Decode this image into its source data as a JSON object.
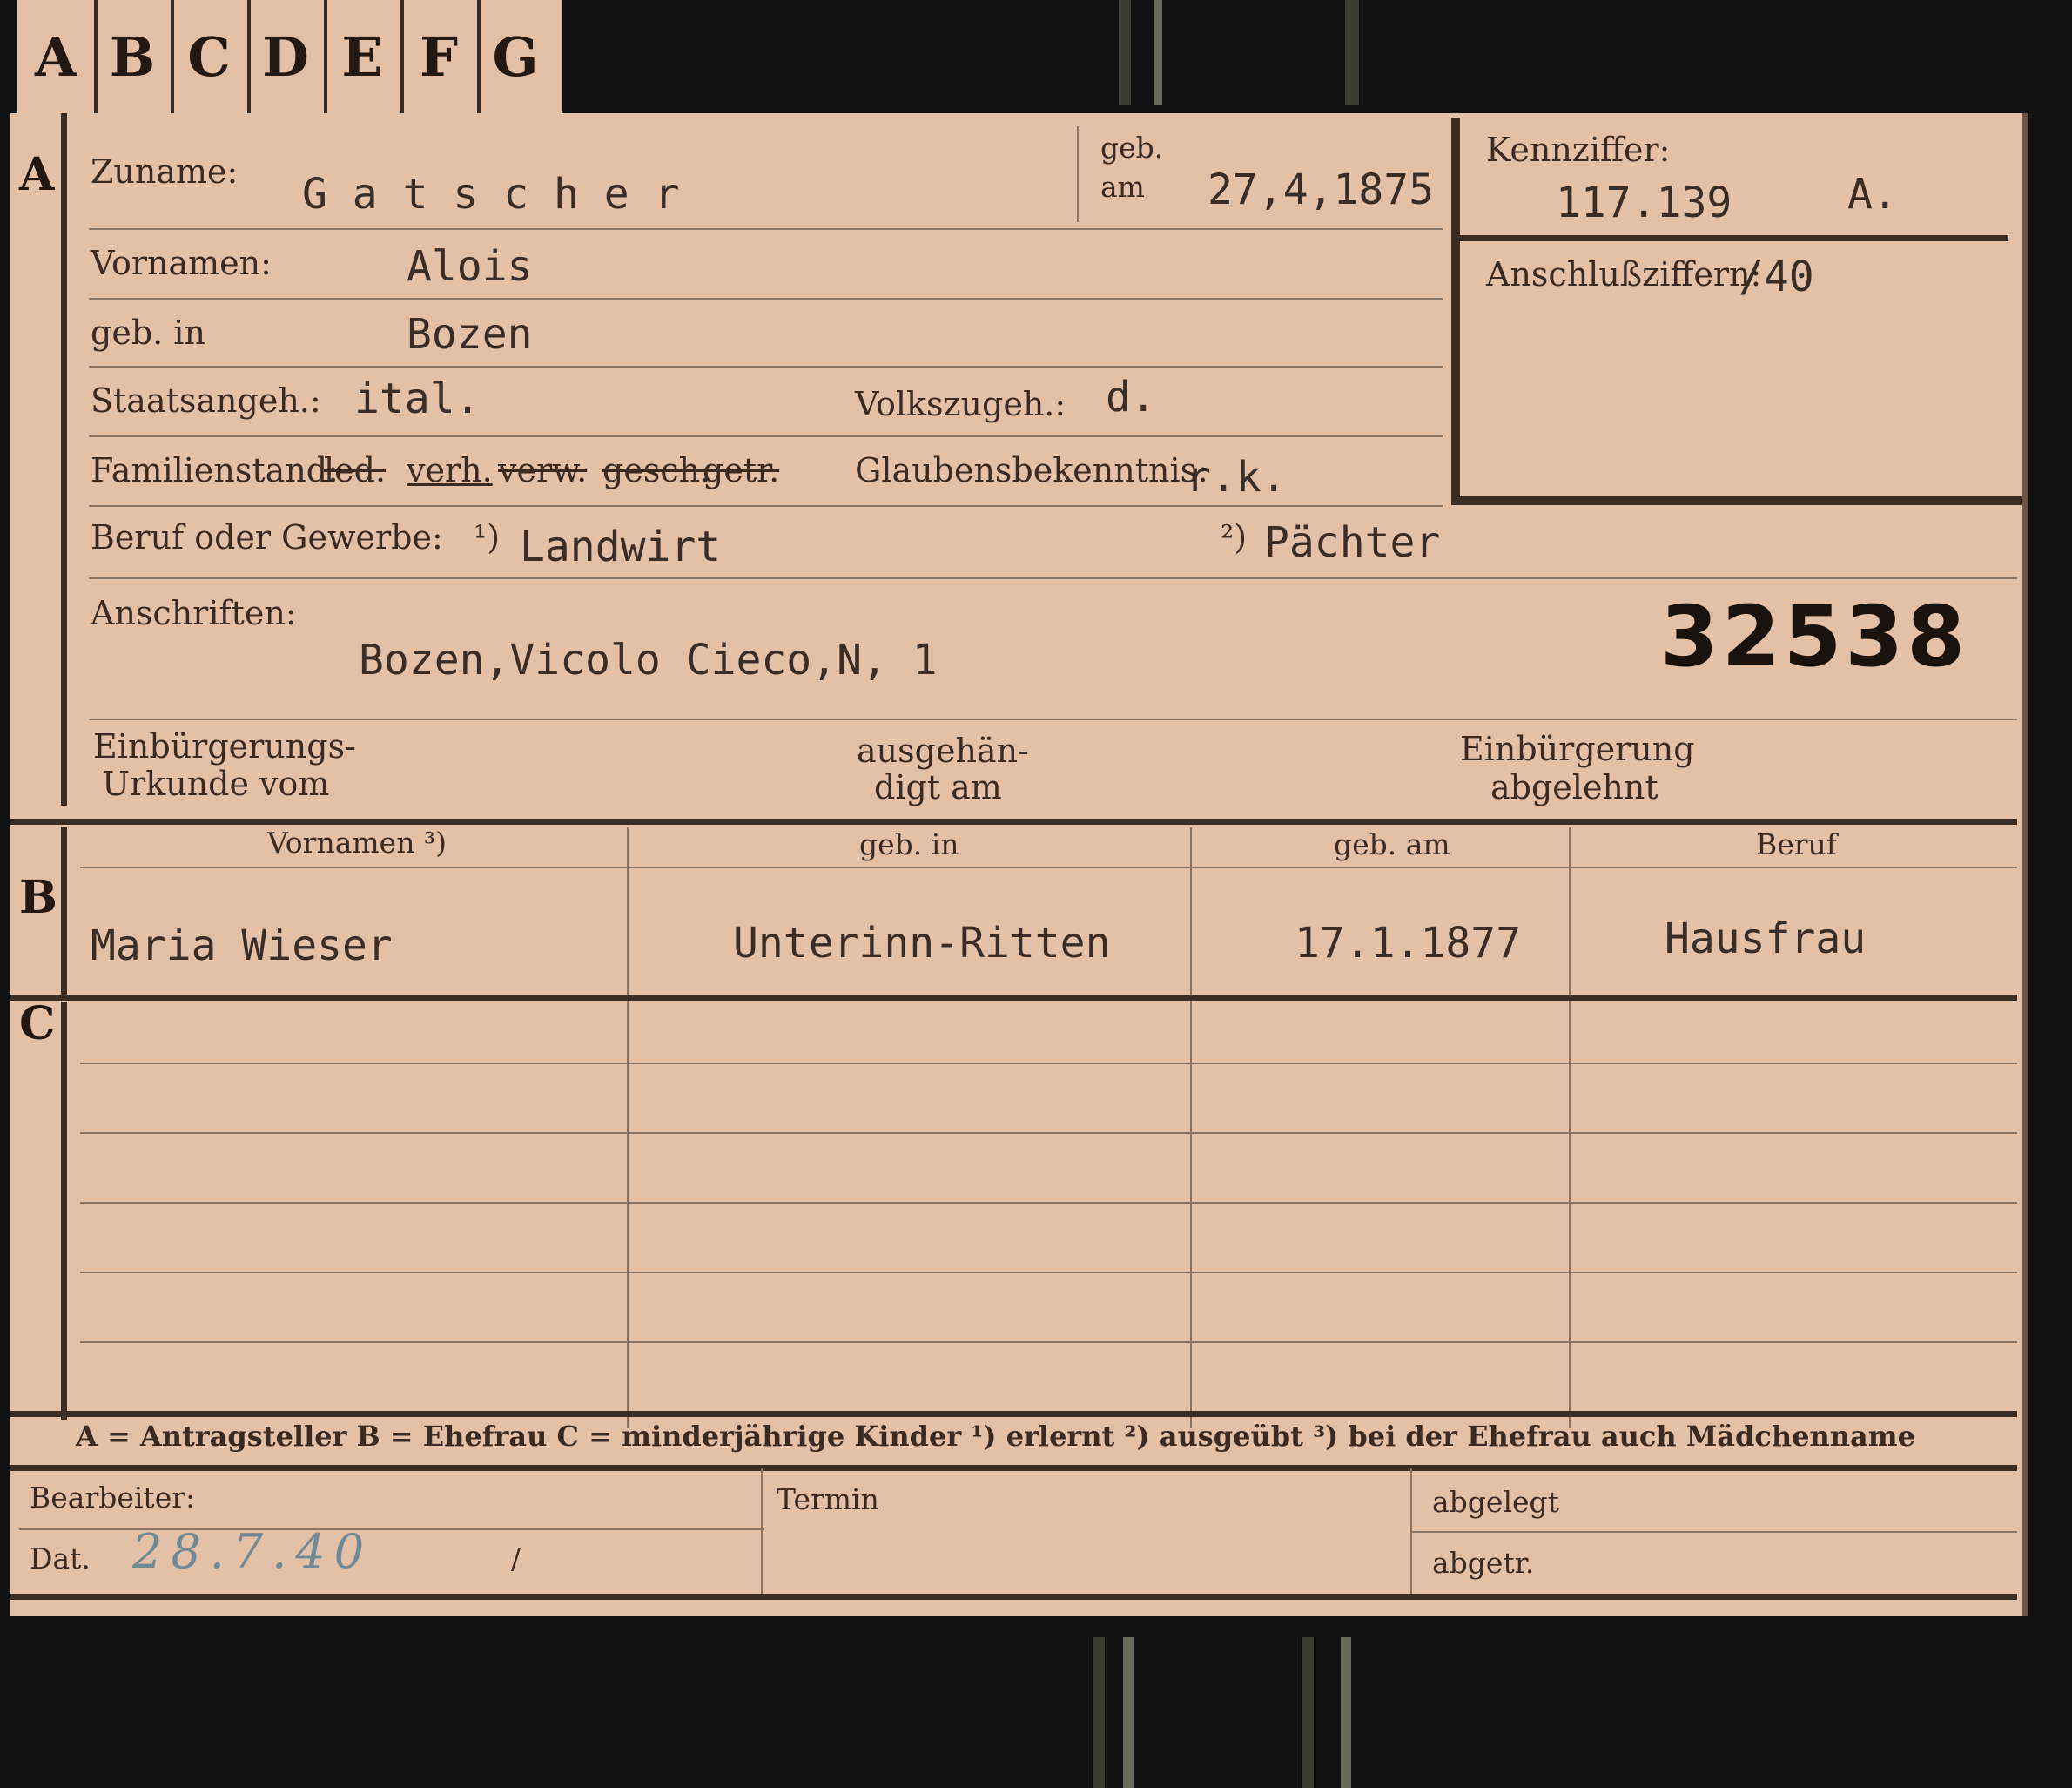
{
  "tabs": [
    "A",
    "B",
    "C",
    "D",
    "E",
    "F",
    "G"
  ],
  "section_letters": {
    "a": "A",
    "b": "B",
    "c": "C"
  },
  "section_a": {
    "zuname_label": "Zuname:",
    "zuname_value": "G a t s c h e r",
    "geb_label_1": "geb.",
    "geb_label_2": "am",
    "geb_value": "27,4,1875",
    "vornamen_label": "Vornamen:",
    "vornamen_value": "Alois",
    "gebin_label": "geb. in",
    "gebin_value": "Bozen",
    "staatsangeh_label": "Staatsangeh.:",
    "staatsangeh_value": "ital.",
    "volkszugeh_label": "Volkszugeh.:",
    "volkszugeh_value": "d.",
    "familienstand_label": "Familienstand:",
    "familienstand_options": [
      "led.",
      "verh.",
      "verw.",
      "gesch.",
      "getr."
    ],
    "glaubens_label": "Glaubensbekenntnis:",
    "glaubens_value": "r.k.",
    "beruf_label": "Beruf oder Gewerbe:",
    "beruf_mark_1": "¹)",
    "beruf_value_1": "Landwirt",
    "beruf_mark_2": "²)",
    "beruf_value_2": "Pächter",
    "anschriften_label": "Anschriften:",
    "anschriften_value": "Bozen,Vicolo Cieco,N, 1",
    "stamp_number": "32538",
    "einb_label_1": "Einbürgerungs-",
    "einb_label_2": "Urkunde vom",
    "ausgeh_label_1": "ausgehän-",
    "ausgeh_label_2": "digt am",
    "abgelehnt_label_1": "Einbürgerung",
    "abgelehnt_label_2": "abgelehnt"
  },
  "kennziffer": {
    "label": "Kennziffer:",
    "value": "117.139",
    "suffix": "A.",
    "anschluss_label": "Anschlußziffern:",
    "anschluss_value": "/40"
  },
  "section_b": {
    "headers": [
      "Vornamen ³)",
      "geb. in",
      "geb. am",
      "Beruf"
    ],
    "row": [
      "Maria Wieser",
      "Unterinn-Ritten",
      "17.1.1877",
      "Hausfrau"
    ]
  },
  "legend": "A = Antragsteller  B = Ehefrau  C = minderjährige Kinder  ¹) erlernt  ²) ausgeübt  ³) bei der Ehefrau auch Mädchenname",
  "footer": {
    "bearbeiter_label": "Bearbeiter:",
    "dat_label": "Dat.",
    "dat_value": "28.7.40",
    "dat_slash": "/",
    "termin_label": "Termin",
    "abgelegt_label": "abgelegt",
    "abgetr_label": "abgetr."
  }
}
